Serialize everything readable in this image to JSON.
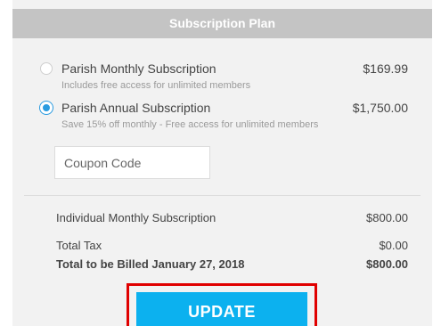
{
  "header": {
    "title": "Subscription Plan"
  },
  "plans": [
    {
      "title": "Parish Monthly Subscription",
      "subtitle": "Includes free access for unlimited members",
      "price": "$169.99",
      "selected": false
    },
    {
      "title": "Parish Annual Subscription",
      "subtitle": "Save 15% off monthly - Free access for unlimited members",
      "price": "$1,750.00",
      "selected": true
    }
  ],
  "coupon": {
    "placeholder": "Coupon Code",
    "value": ""
  },
  "summary": {
    "line1_label": "Individual Monthly Subscription",
    "line1_value": "$800.00",
    "tax_label": "Total Tax",
    "tax_value": "$0.00",
    "total_label": "Total to be Billed January 27, 2018",
    "total_value": "$800.00"
  },
  "actions": {
    "update_label": "UPDATE"
  },
  "colors": {
    "accent": "#0cb1ef",
    "radio_selected": "#2a9be0",
    "highlight_border": "#e00000",
    "header_bg": "#c4c4c4",
    "panel_bg": "#f2f2f2"
  }
}
